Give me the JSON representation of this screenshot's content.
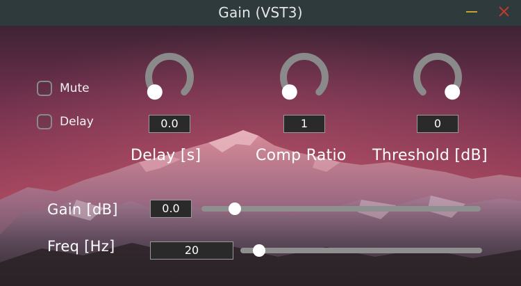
{
  "window": {
    "title": "Gain (VST3)",
    "minimize_icon": "minimize-icon",
    "close_icon": "close-icon",
    "minimize_color": "#c9a227",
    "close_color": "#c0392b"
  },
  "checkboxes": [
    {
      "label": "Mute",
      "checked": false
    },
    {
      "label": "Delay",
      "checked": false
    }
  ],
  "knobs": [
    {
      "label": "Delay [s]",
      "value": "0.0",
      "level": 0.0
    },
    {
      "label": "Comp Ratio",
      "value": "1",
      "level": 0.0
    },
    {
      "label": "Threshold [dB]",
      "value": "0",
      "level": 1.0
    }
  ],
  "sliders": [
    {
      "label": "Gain [dB]",
      "value": "0.0",
      "level": 0.07
    },
    {
      "label": "Freq [Hz]",
      "value": "20",
      "level": 0.02
    }
  ]
}
